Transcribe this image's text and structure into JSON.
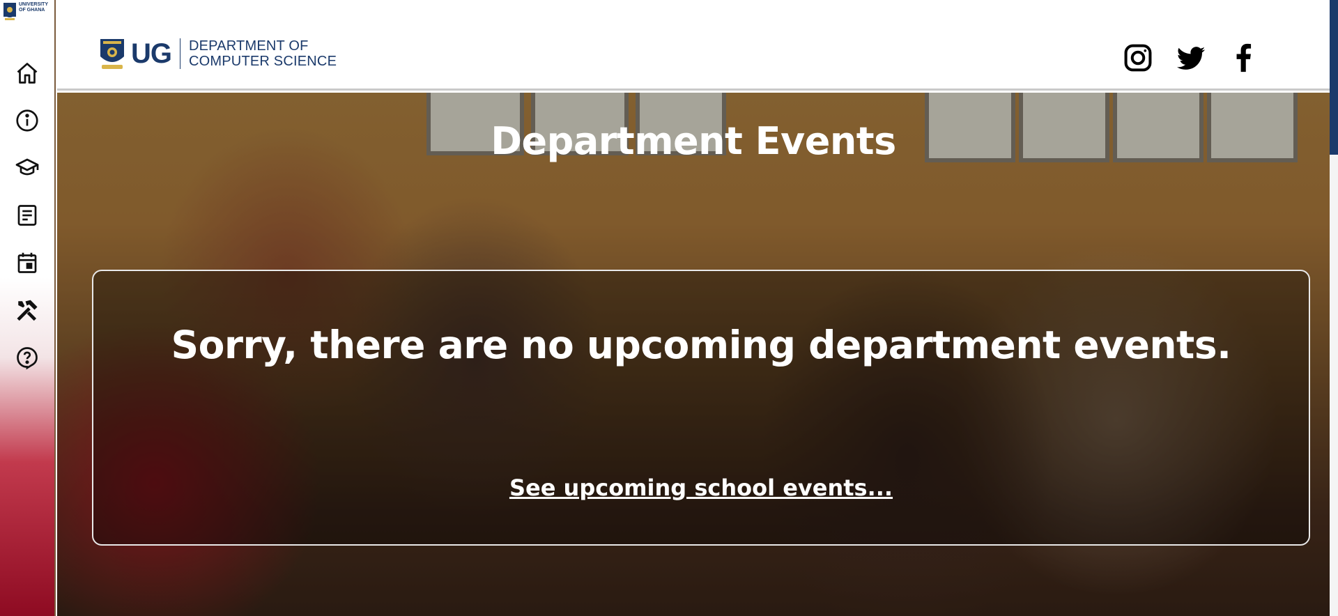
{
  "sidebar": {
    "logo_text_line1": "UNIVERSITY",
    "logo_text_line2": "OF GHANA",
    "items": [
      {
        "name": "home",
        "icon": "home-icon"
      },
      {
        "name": "about",
        "icon": "info-icon"
      },
      {
        "name": "academics",
        "icon": "graduation-cap-icon"
      },
      {
        "name": "news",
        "icon": "article-icon"
      },
      {
        "name": "events",
        "icon": "calendar-icon"
      },
      {
        "name": "resources",
        "icon": "tools-icon"
      },
      {
        "name": "help",
        "icon": "help-icon"
      }
    ]
  },
  "header": {
    "brand_short": "UG",
    "brand_dept_line1": "DEPARTMENT OF",
    "brand_dept_line2": "COMPUTER SCIENCE",
    "social": [
      {
        "name": "instagram",
        "icon": "instagram-icon"
      },
      {
        "name": "twitter",
        "icon": "twitter-icon"
      },
      {
        "name": "facebook",
        "icon": "facebook-icon"
      }
    ]
  },
  "hero": {
    "title": "Department Events",
    "empty_message": "Sorry, there are no upcoming department events.",
    "link_text": "See upcoming school events..."
  },
  "colors": {
    "brand_blue": "#1b3a6b",
    "sidebar_crimson": "#8e0b22",
    "text_light": "#ffffff"
  }
}
